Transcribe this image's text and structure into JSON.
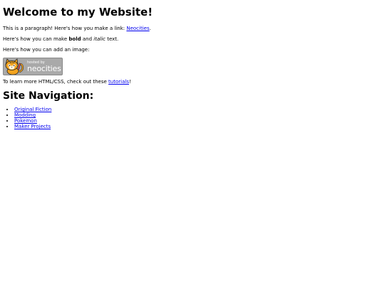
{
  "heading": "Welcome to my Website!",
  "intro": {
    "text_before": "This is a paragraph! Here's how you make a link: ",
    "link_label": "Neocities",
    "text_after": "."
  },
  "formatting": {
    "text_before": "Here's how you can make ",
    "bold": "bold",
    "text_middle": " and ",
    "italic": "italic",
    "text_after": " text."
  },
  "image_paragraph": "Here's how you can add an image:",
  "image": {
    "icon": "neocities-cat-icon",
    "small_text": "hosted by",
    "big_text": "neocities",
    "badge_color": "#a9a9a9"
  },
  "learn": {
    "text_before": "To learn more HTML/CSS, check out these ",
    "link_label": "tutorials",
    "text_after": "!"
  },
  "nav_heading": "Site Navigation:",
  "nav_items": [
    "Original Fiction",
    "Modding",
    "Pokemon",
    "Maker Projects"
  ],
  "colors": {
    "link": "#0000ee",
    "text": "#000000",
    "background": "#ffffff"
  }
}
